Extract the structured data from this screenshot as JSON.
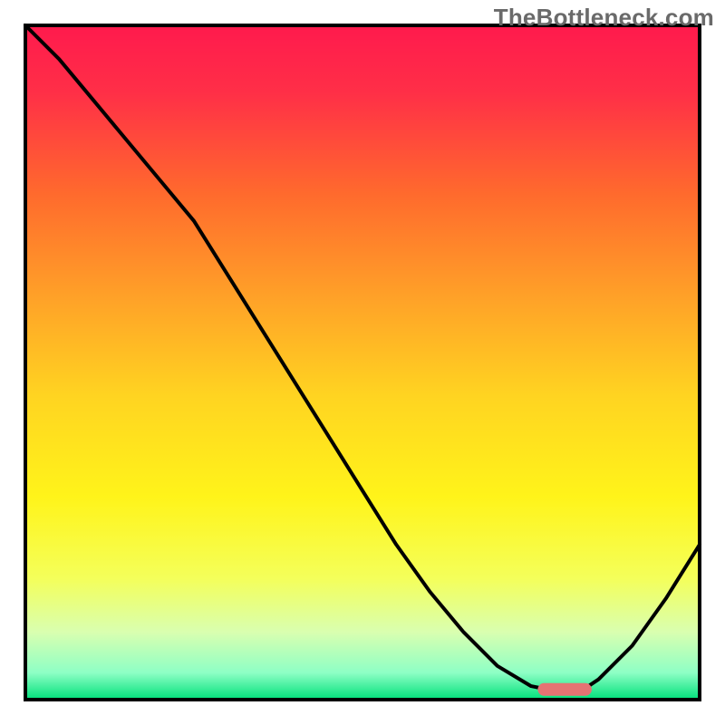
{
  "watermark": "TheBottleneck.com",
  "chart_data": {
    "type": "line",
    "title": "",
    "xlabel": "",
    "ylabel": "",
    "xlim": [
      0,
      100
    ],
    "ylim": [
      0,
      100
    ],
    "x": [
      0,
      5,
      10,
      15,
      20,
      25,
      30,
      35,
      40,
      45,
      50,
      55,
      60,
      65,
      70,
      75,
      80,
      82,
      85,
      90,
      95,
      100
    ],
    "values": [
      100,
      95,
      89,
      83,
      77,
      71,
      63,
      55,
      47,
      39,
      31,
      23,
      16,
      10,
      5,
      2,
      1,
      1,
      3,
      8,
      15,
      23
    ],
    "optimal_marker": {
      "x_start": 76,
      "x_end": 84,
      "y": 1.5
    },
    "gradient_stops": [
      {
        "offset": 0.0,
        "color": "#ff1a4d"
      },
      {
        "offset": 0.1,
        "color": "#ff2f47"
      },
      {
        "offset": 0.25,
        "color": "#ff6a2d"
      },
      {
        "offset": 0.4,
        "color": "#ffa028"
      },
      {
        "offset": 0.55,
        "color": "#ffd421"
      },
      {
        "offset": 0.7,
        "color": "#fff41a"
      },
      {
        "offset": 0.82,
        "color": "#f4ff5a"
      },
      {
        "offset": 0.9,
        "color": "#d9ffb0"
      },
      {
        "offset": 0.96,
        "color": "#8effc5"
      },
      {
        "offset": 1.0,
        "color": "#00e07a"
      }
    ]
  }
}
